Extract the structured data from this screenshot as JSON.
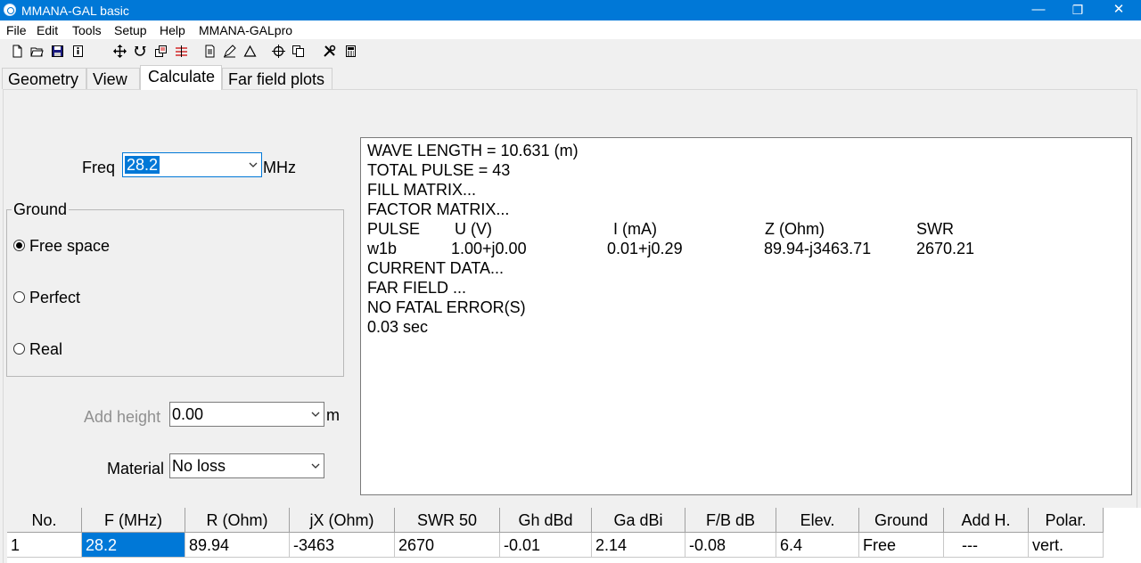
{
  "window": {
    "title": "MMANA-GAL basic",
    "controls": {
      "minimize": "—",
      "restore": "❐",
      "close": "✕"
    }
  },
  "menu": [
    "File",
    "Edit",
    "Tools",
    "Setup",
    "Help",
    "MMANA-GALpro"
  ],
  "toolbar": {
    "icons": [
      "new-file-icon",
      "open-folder-icon",
      "save-icon",
      "info-icon",
      "move-icon",
      "rotate-icon",
      "copy-element-icon",
      "split-wire-icon",
      "page-icon",
      "pen-icon",
      "triangle-icon",
      "target-icon",
      "duplicate-icon",
      "tools-icon",
      "calculator-icon"
    ]
  },
  "tabs": [
    {
      "label": "Geometry",
      "active": false
    },
    {
      "label": "View",
      "active": false
    },
    {
      "label": "Calculate",
      "active": true
    },
    {
      "label": "Far field plots",
      "active": false
    }
  ],
  "freq": {
    "label": "Freq",
    "value": "28.2",
    "unit": "MHz"
  },
  "ground": {
    "title": "Ground",
    "options": [
      {
        "label": "Free space",
        "checked": true
      },
      {
        "label": "Perfect",
        "checked": false
      },
      {
        "label": "Real",
        "checked": false
      }
    ]
  },
  "add_height": {
    "label": "Add height",
    "value": "0.00",
    "unit": "m"
  },
  "material": {
    "label": "Material",
    "value": "No loss"
  },
  "output": {
    "lines_top": [
      "WAVE LENGTH = 10.631 (m)",
      "TOTAL PULSE = 43",
      "FILL MATRIX...",
      "FACTOR MATRIX..."
    ],
    "table_header": [
      "PULSE",
      "U (V)",
      "I (mA)",
      "Z (Ohm)",
      "SWR"
    ],
    "table_row": [
      "w1b",
      "1.00+j0.00",
      "0.01+j0.29",
      "89.94-j3463.71",
      "2670.21"
    ],
    "lines_bottom": [
      "CURRENT DATA...",
      "FAR FIELD ...",
      "NO FATAL ERROR(S)",
      "0.03 sec"
    ]
  },
  "results": {
    "columns": [
      "No.",
      "F (MHz)",
      "R (Ohm)",
      "jX (Ohm)",
      "SWR 50",
      "Gh dBd",
      "Ga dBi",
      "F/B dB",
      "Elev.",
      "Ground",
      "Add H.",
      "Polar."
    ],
    "rows": [
      [
        "1",
        "28.2",
        "89.94",
        "-3463",
        "2670",
        "-0.01",
        "2.14",
        "-0.08",
        "6.4",
        "Free",
        "---",
        "vert."
      ]
    ]
  },
  "colors": {
    "titlebar": "#0078d7",
    "selection": "#0078d7"
  }
}
